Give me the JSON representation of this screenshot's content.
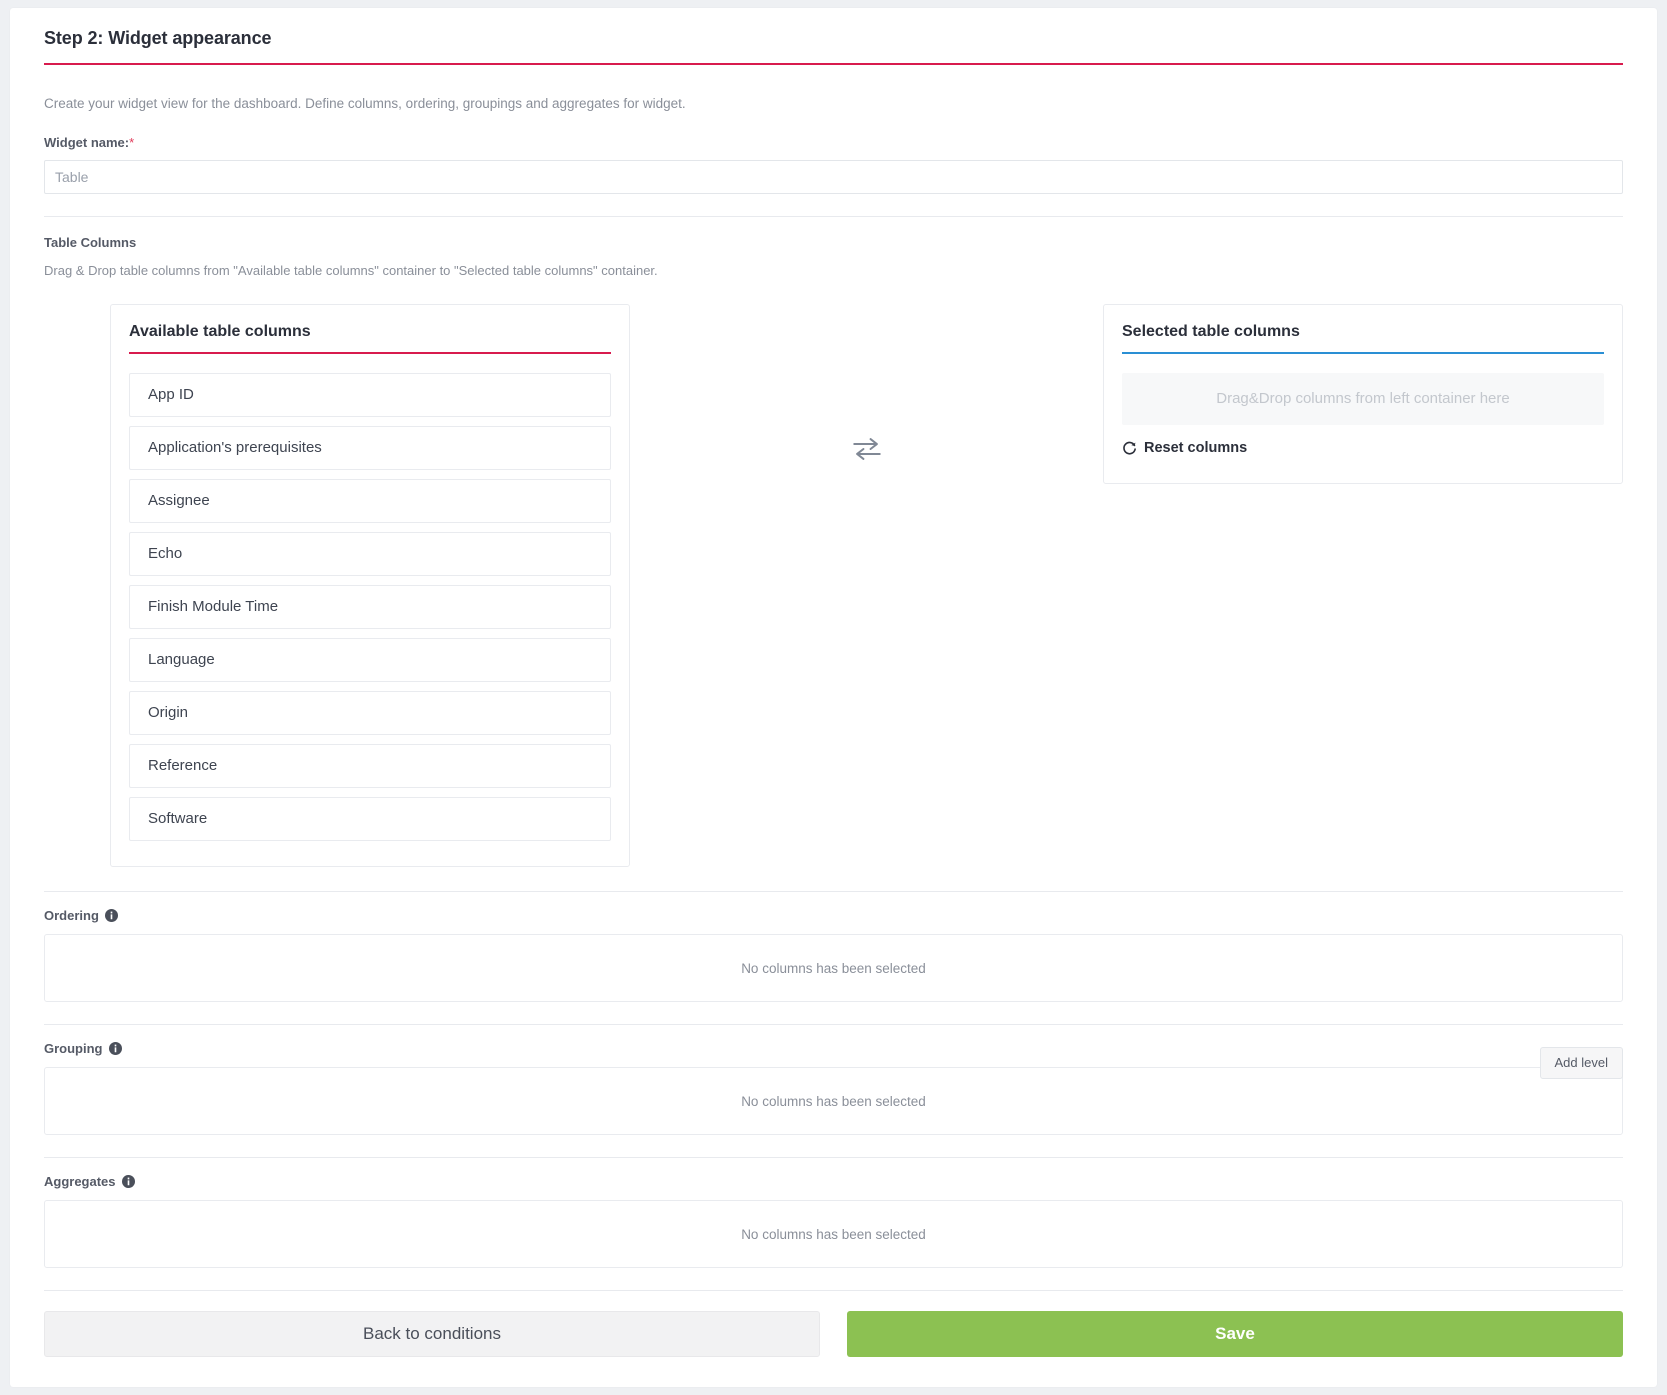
{
  "header": {
    "title": "Step 2: Widget appearance",
    "accent_color": "#d81b4e"
  },
  "intro": {
    "text": "Create your widget view for the dashboard. Define columns, ordering, groupings and aggregates for widget."
  },
  "widget_name": {
    "label": "Widget name:",
    "required_marker": "*",
    "value": "",
    "placeholder": "Table"
  },
  "table_columns": {
    "section_title": "Table Columns",
    "section_sub": "Drag & Drop table columns from \"Available table columns\" container to \"Selected table columns\" container.",
    "available": {
      "title": "Available table columns",
      "rule_color": "#d81b4e",
      "items": [
        "App ID",
        "Application's prerequisites",
        "Assignee",
        "Echo",
        "Finish Module Time",
        "Language",
        "Origin",
        "Reference",
        "Software"
      ]
    },
    "swap_icon": "swap-horizontal-icon",
    "selected": {
      "title": "Selected table columns",
      "rule_color": "#2a8fd4",
      "dropzone_text": "Drag&Drop columns from left container here",
      "reset_label": "Reset columns",
      "reset_icon": "refresh-icon"
    }
  },
  "ordering": {
    "label": "Ordering",
    "info_icon": "info-icon",
    "empty_text": "No columns has been selected"
  },
  "grouping": {
    "label": "Grouping",
    "info_icon": "info-icon",
    "empty_text": "No columns has been selected",
    "add_level_label": "Add level"
  },
  "aggregates": {
    "label": "Aggregates",
    "info_icon": "info-icon",
    "empty_text": "No columns has been selected"
  },
  "footer": {
    "back_label": "Back to conditions",
    "save_label": "Save",
    "save_color": "#8cc152"
  }
}
